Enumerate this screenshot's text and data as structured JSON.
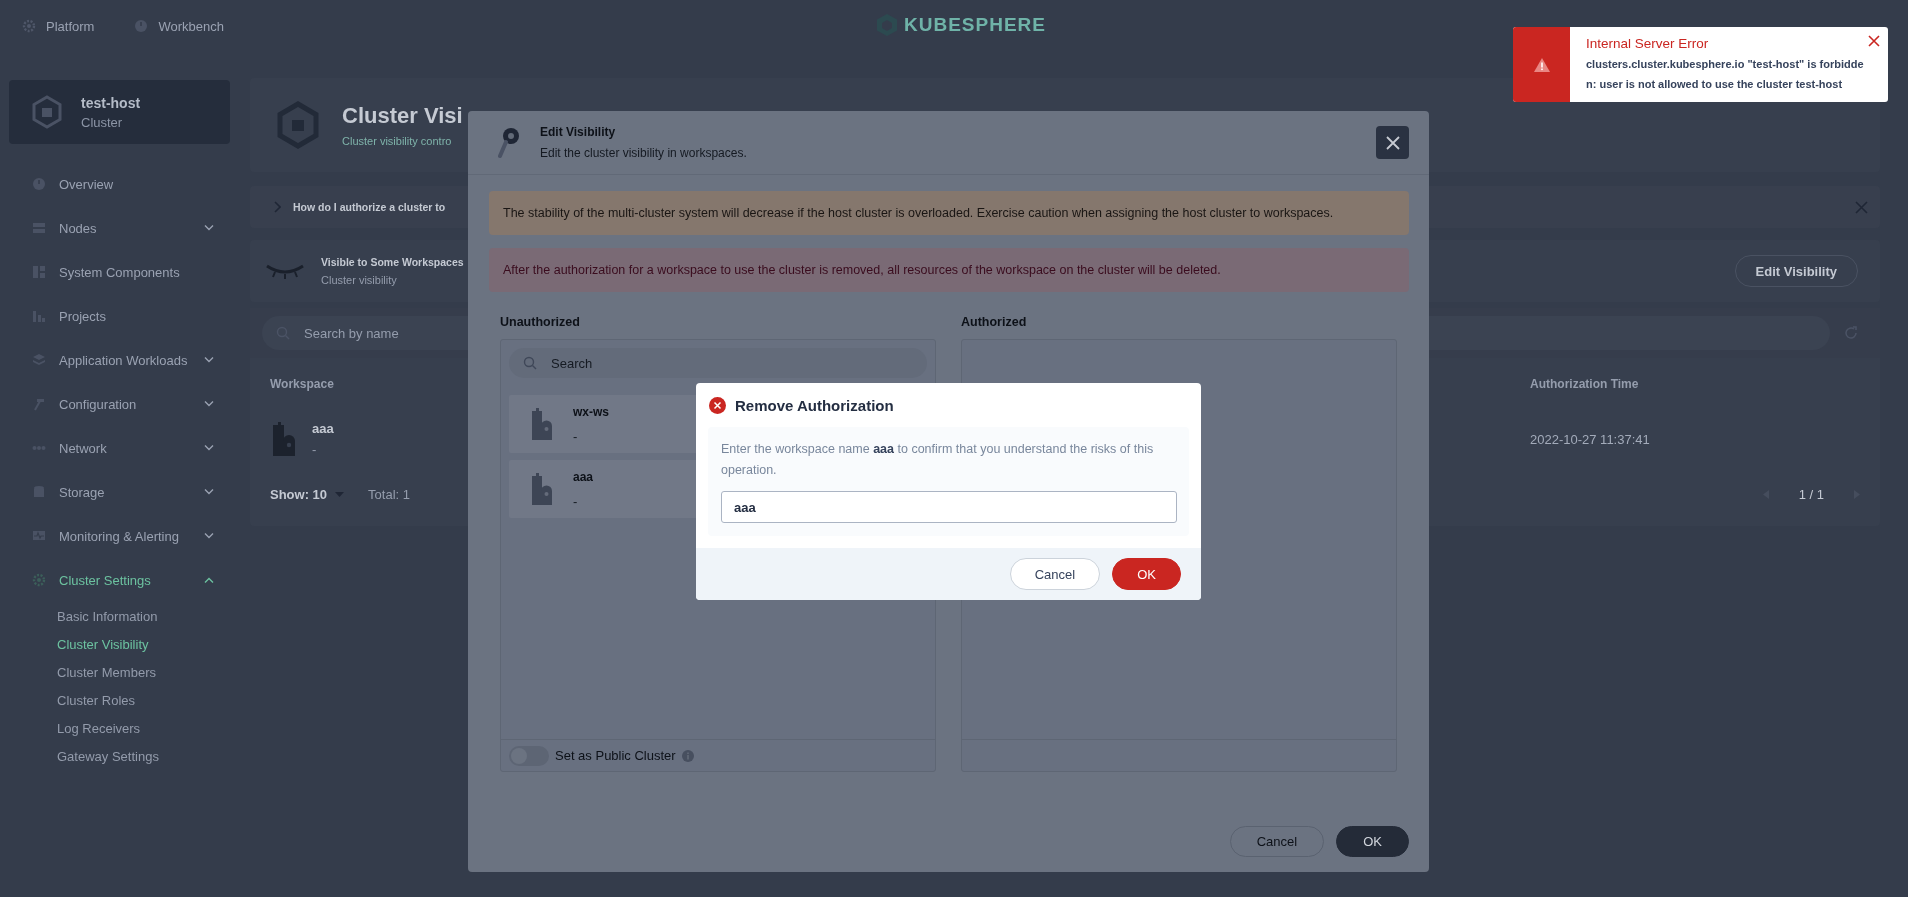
{
  "top_nav": {
    "items": [
      {
        "label": "Platform"
      },
      {
        "label": "Workbench"
      }
    ],
    "logo": "KUBESPHERE"
  },
  "cluster_card": {
    "name": "test-host",
    "type": "Cluster"
  },
  "sidebar": {
    "items": [
      {
        "label": "Overview",
        "kind": "link",
        "selected": false
      },
      {
        "label": "Nodes",
        "kind": "group",
        "selected": false,
        "expanded": false
      },
      {
        "label": "System Components",
        "kind": "link",
        "selected": false
      },
      {
        "label": "Projects",
        "kind": "link",
        "selected": false
      },
      {
        "label": "Application Workloads",
        "kind": "group",
        "selected": false,
        "expanded": false
      },
      {
        "label": "Configuration",
        "kind": "group",
        "selected": false,
        "expanded": false
      },
      {
        "label": "Network",
        "kind": "group",
        "selected": false,
        "expanded": false
      },
      {
        "label": "Storage",
        "kind": "group",
        "selected": false,
        "expanded": false
      },
      {
        "label": "Monitoring & Alerting",
        "kind": "group",
        "selected": false,
        "expanded": false
      },
      {
        "label": "Cluster Settings",
        "kind": "group",
        "selected": true,
        "expanded": true,
        "children": [
          {
            "label": "Basic Information",
            "selected": false
          },
          {
            "label": "Cluster Visibility",
            "selected": true
          },
          {
            "label": "Cluster Members",
            "selected": false
          },
          {
            "label": "Cluster Roles",
            "selected": false
          },
          {
            "label": "Log Receivers",
            "selected": false
          },
          {
            "label": "Gateway Settings",
            "selected": false
          }
        ]
      }
    ]
  },
  "page_header": {
    "title": "Cluster Visi",
    "description": "Cluster visibility contro"
  },
  "help_banner": {
    "text": "How do I authorize a cluster to"
  },
  "visibility_card": {
    "title": "Visible to Some Workspaces",
    "subtitle": "Cluster visibility",
    "button": "Edit Visibility"
  },
  "table": {
    "search_placeholder": "Search by name",
    "columns": [
      "Workspace",
      "Authorization Time"
    ],
    "rows": [
      {
        "name": "aaa",
        "description": "-",
        "time": "2022-10-27 11:37:41"
      }
    ],
    "page_size": "Show: 10",
    "total": "Total: 1",
    "pagination": "1 / 1"
  },
  "edit_visibility": {
    "title": "Edit Visibility",
    "description": "Edit the cluster visibility in workspaces.",
    "alerts": [
      {
        "kind": "warning",
        "text": "The stability of the multi-cluster system will decrease if the host cluster is overloaded. Exercise caution when assigning the host cluster to workspaces."
      },
      {
        "kind": "error",
        "text": "After the authorization for a workspace to use the cluster is removed, all resources of the workspace on the cluster will be deleted."
      }
    ],
    "unauthorized": {
      "label": "Unauthorized",
      "search_placeholder": "Search",
      "items": [
        {
          "name": "wx-ws",
          "description": "-"
        },
        {
          "name": "aaa",
          "description": "-"
        }
      ],
      "public_toggle": {
        "label": "Set as Public Cluster",
        "on": false
      }
    },
    "authorized": {
      "label": "Authorized"
    },
    "buttons": [
      {
        "label": "Cancel",
        "kind": "secondary"
      },
      {
        "label": "OK",
        "kind": "primary"
      }
    ]
  },
  "confirm_dialog": {
    "title": "Remove Authorization",
    "message": "Enter the workspace name **aaa** to confirm that you understand the risks of this operation.",
    "value": "aaa",
    "buttons": [
      {
        "label": "Cancel",
        "kind": "secondary"
      },
      {
        "label": "OK",
        "kind": "danger"
      }
    ]
  },
  "toast": {
    "title": "Internal Server Error",
    "message": "clusters.cluster.kubesphere.io \"test-host\" is forbidden: user is not allowed to use the cluster test-host"
  }
}
